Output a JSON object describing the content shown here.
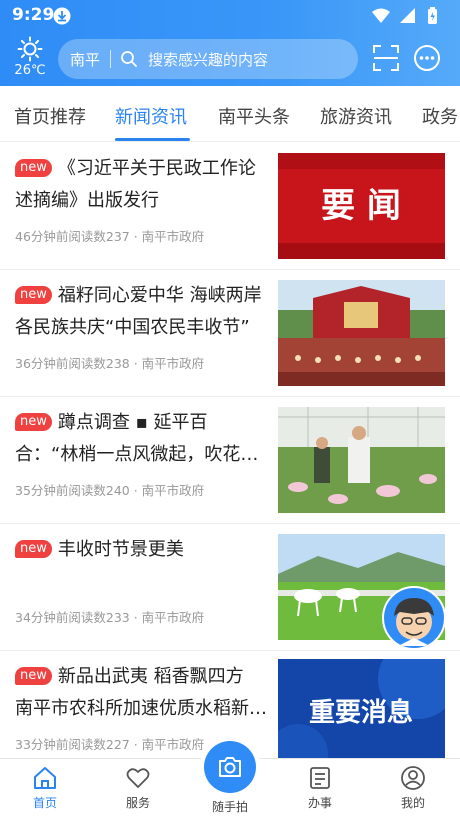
{
  "status_bar": {
    "time": "9:29"
  },
  "header": {
    "weather": {
      "icon": "sun-icon",
      "temperature": "26℃"
    },
    "search": {
      "city": "南平",
      "placeholder": "搜索感兴趣的内容"
    },
    "actions": [
      "scan-icon",
      "message-icon"
    ]
  },
  "tabs": {
    "items": [
      "首页推荐",
      "新闻资讯",
      "南平头条",
      "旅游资讯",
      "政务"
    ],
    "active_index": 1
  },
  "news": [
    {
      "badge": "new",
      "title": "《习近平关于民政工作论述摘编》出版发行",
      "meta": "46分钟前阅读数237 · 南平市政府",
      "thumb_text": "要 闻"
    },
    {
      "badge": "new",
      "title": "福籽同心爱中华 海峡两岸各民族共庆“中国农民丰收节”",
      "meta": "36分钟前阅读数238 · 南平市政府",
      "thumb_text": ""
    },
    {
      "badge": "new",
      "title": "蹲点调查 ▪ 延平百合：“林梢一点风微起，吹花送香过墙来”",
      "meta": "35分钟前阅读数240 · 南平市政府",
      "thumb_text": ""
    },
    {
      "badge": "new",
      "title": "丰收时节景更美",
      "meta": "34分钟前阅读数233 · 南平市政府",
      "thumb_text": ""
    },
    {
      "badge": "new",
      "title": "新品出武夷 稻香飘四方 南平市农科所加速优质水稻新品种推广",
      "meta": "33分钟前阅读数227 · 南平市政府",
      "thumb_text": "重要消息"
    }
  ],
  "bottom_nav": {
    "items": [
      {
        "label": "首页",
        "icon": "home-icon"
      },
      {
        "label": "服务",
        "icon": "heart-icon"
      },
      {
        "label": "随手拍",
        "icon": "camera-icon"
      },
      {
        "label": "办事",
        "icon": "document-icon"
      },
      {
        "label": "我的",
        "icon": "user-icon"
      }
    ],
    "active_index": 0
  },
  "colors": {
    "primary": "#2f8cf6",
    "badge": "#f04141",
    "meta": "#999999"
  }
}
